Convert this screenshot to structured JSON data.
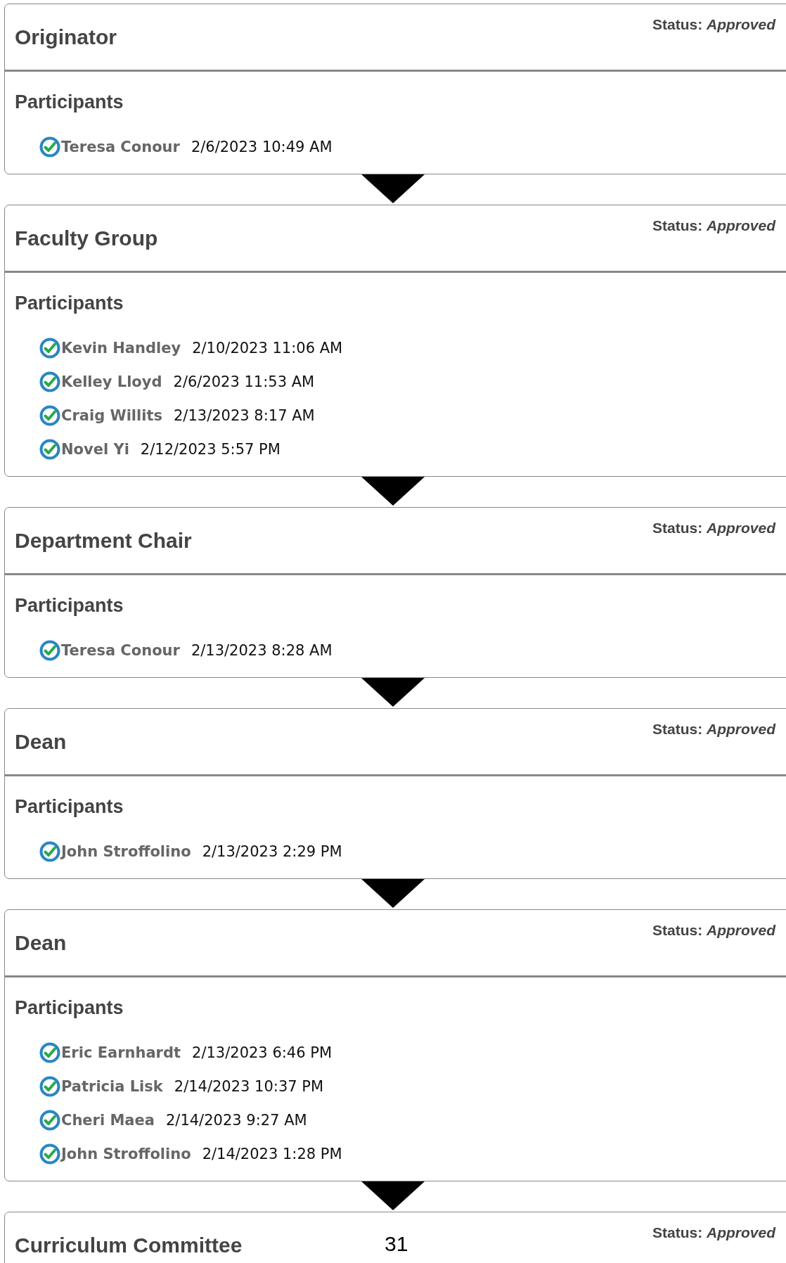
{
  "steps": [
    {
      "title": "Originator",
      "status_label": "Status:",
      "status": "Approved",
      "participants_heading": "Participants",
      "participants": [
        {
          "name": "Teresa Conour",
          "date": "2/6/2023 10:49 AM",
          "approved": true
        }
      ]
    },
    {
      "title": "Faculty Group",
      "status_label": "Status:",
      "status": "Approved",
      "participants_heading": "Participants",
      "participants": [
        {
          "name": "Kevin Handley",
          "date": "2/10/2023 11:06 AM",
          "approved": true
        },
        {
          "name": "Kelley Lloyd",
          "date": "2/6/2023 11:53 AM",
          "approved": true
        },
        {
          "name": "Craig Willits",
          "date": "2/13/2023 8:17 AM",
          "approved": true
        },
        {
          "name": "Novel Yi",
          "date": "2/12/2023 5:57 PM",
          "approved": true
        }
      ]
    },
    {
      "title": "Department Chair",
      "status_label": "Status:",
      "status": "Approved",
      "participants_heading": "Participants",
      "participants": [
        {
          "name": "Teresa Conour",
          "date": "2/13/2023 8:28 AM",
          "approved": true
        }
      ]
    },
    {
      "title": "Dean",
      "status_label": "Status:",
      "status": "Approved",
      "participants_heading": "Participants",
      "participants": [
        {
          "name": "John Stroffolino",
          "date": "2/13/2023 2:29 PM",
          "approved": true
        }
      ]
    },
    {
      "title": "Dean",
      "status_label": "Status:",
      "status": "Approved",
      "participants_heading": "Participants",
      "participants": [
        {
          "name": "Eric Earnhardt",
          "date": "2/13/2023 6:46 PM",
          "approved": true
        },
        {
          "name": "Patricia Lisk",
          "date": "2/14/2023 10:37 PM",
          "approved": true
        },
        {
          "name": "Cheri Maea",
          "date": "2/14/2023 9:27 AM",
          "approved": true
        },
        {
          "name": "John Stroffolino",
          "date": "2/14/2023 1:28 PM",
          "approved": true
        }
      ]
    },
    {
      "title": "Curriculum Committee",
      "status_label": "Status:",
      "status": "Approved"
    }
  ],
  "page_number": "31"
}
